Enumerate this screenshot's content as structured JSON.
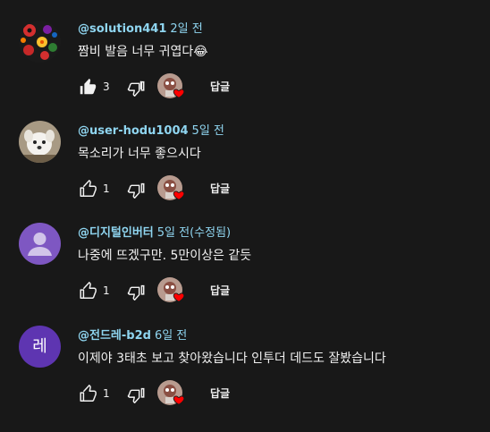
{
  "comments": [
    {
      "author": "@solution441",
      "time": "2일 전",
      "text": "짬비 발음 너무 귀엽다",
      "emoji": "😂",
      "likes": "3",
      "liked": true,
      "reply_label": "답글",
      "avatar": "flower-pattern-avatar"
    },
    {
      "author": "@user-hodu1004",
      "time": "5일 전",
      "text": "목소리가 너무 좋으시다",
      "likes": "1",
      "liked": false,
      "reply_label": "답글",
      "avatar": "white-dog-avatar"
    },
    {
      "author": "@디지털인버터",
      "time": "5일 전(수정됨)",
      "text": "나중에 뜨겠구만. 5만이상은 같듯",
      "likes": "1",
      "liked": false,
      "reply_label": "답글",
      "avatar": "default-person-avatar"
    },
    {
      "author": "@전드레-b2d",
      "time": "6일 전",
      "text": "이제야 3태초 보고 찾아왔습니다 인투더 데드도 잘봤습니다",
      "likes": "1",
      "liked": false,
      "reply_label": "답글",
      "avatar_letter": "레",
      "avatar_color": "#5e35b1"
    }
  ],
  "colors": {
    "background": "#181818",
    "author": "#8fd5f0",
    "text": "#f1f1f1",
    "heart": "#ff0000"
  }
}
